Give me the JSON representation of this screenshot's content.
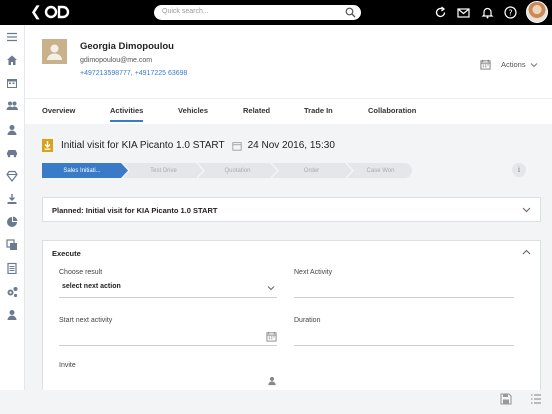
{
  "topbar": {
    "back_icon": "chevron-left-icon",
    "logo_icon": "od-logo-icon",
    "search": {
      "placeholder": "Quick search..."
    },
    "icons": [
      "refresh-icon",
      "mail-icon",
      "bell-icon",
      "help-icon",
      "profile-avatar"
    ]
  },
  "sidebar": {
    "items": [
      "menu-icon",
      "home-icon",
      "calendar-icon",
      "users-icon",
      "person-icon",
      "car-icon",
      "diamond-icon",
      "download-icon",
      "pie-chart-icon",
      "copy-icon",
      "clipboard-icon",
      "cogs-icon",
      "contact-icon"
    ],
    "bottom": "settings-icon"
  },
  "contact": {
    "name": "Georgia Dimopoulou",
    "email": "gdimopoulou@me.com",
    "phones": "+497213598777, +4917225 63698"
  },
  "actions_label": "Actions",
  "tabs": [
    {
      "label": "Overview"
    },
    {
      "label": "Activities"
    },
    {
      "label": "Vehicles"
    },
    {
      "label": "Related"
    },
    {
      "label": "Trade In"
    },
    {
      "label": "Collaboration"
    }
  ],
  "activity": {
    "title": "Initial visit  for  KIA Picanto 1.0 START",
    "date": "24 Nov 2016, 15:30"
  },
  "pipeline": [
    {
      "label": "Sales Initiati..."
    },
    {
      "label": "Test Drive"
    },
    {
      "label": "Quotation"
    },
    {
      "label": "Order"
    },
    {
      "label": "Case Won"
    }
  ],
  "planned_title": "Planned: Initial visit for KIA Picanto 1.0 START",
  "execute": {
    "title": "Execute",
    "choose_result_label": "Choose result",
    "choose_result_value": "select next action",
    "next_activity_label": "Next Activity",
    "start_next_label": "Start next activity",
    "duration_label": "Duration",
    "invite_label": "Invite"
  },
  "colors": {
    "accent": "#3a7bc8",
    "topbar": "#000000",
    "active_stage": "#3a7bc8",
    "stage_inactive": "#e4e6ea"
  }
}
